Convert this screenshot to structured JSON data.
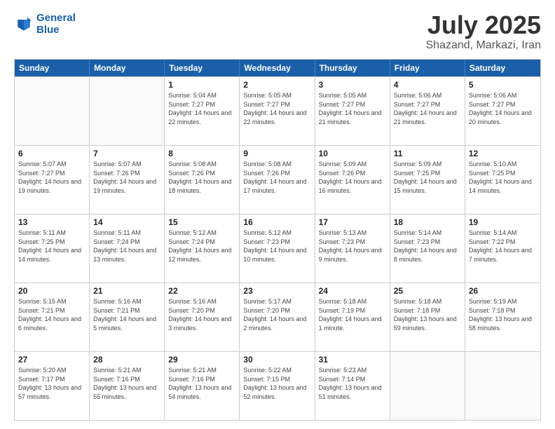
{
  "header": {
    "logo_line1": "General",
    "logo_line2": "Blue",
    "month": "July 2025",
    "location": "Shazand, Markazi, Iran"
  },
  "weekdays": [
    "Sunday",
    "Monday",
    "Tuesday",
    "Wednesday",
    "Thursday",
    "Friday",
    "Saturday"
  ],
  "rows": [
    [
      {
        "day": "",
        "sunrise": "",
        "sunset": "",
        "daylight": ""
      },
      {
        "day": "",
        "sunrise": "",
        "sunset": "",
        "daylight": ""
      },
      {
        "day": "1",
        "sunrise": "Sunrise: 5:04 AM",
        "sunset": "Sunset: 7:27 PM",
        "daylight": "Daylight: 14 hours and 22 minutes."
      },
      {
        "day": "2",
        "sunrise": "Sunrise: 5:05 AM",
        "sunset": "Sunset: 7:27 PM",
        "daylight": "Daylight: 14 hours and 22 minutes."
      },
      {
        "day": "3",
        "sunrise": "Sunrise: 5:05 AM",
        "sunset": "Sunset: 7:27 PM",
        "daylight": "Daylight: 14 hours and 21 minutes."
      },
      {
        "day": "4",
        "sunrise": "Sunrise: 5:06 AM",
        "sunset": "Sunset: 7:27 PM",
        "daylight": "Daylight: 14 hours and 21 minutes."
      },
      {
        "day": "5",
        "sunrise": "Sunrise: 5:06 AM",
        "sunset": "Sunset: 7:27 PM",
        "daylight": "Daylight: 14 hours and 20 minutes."
      }
    ],
    [
      {
        "day": "6",
        "sunrise": "Sunrise: 5:07 AM",
        "sunset": "Sunset: 7:27 PM",
        "daylight": "Daylight: 14 hours and 19 minutes."
      },
      {
        "day": "7",
        "sunrise": "Sunrise: 5:07 AM",
        "sunset": "Sunset: 7:26 PM",
        "daylight": "Daylight: 14 hours and 19 minutes."
      },
      {
        "day": "8",
        "sunrise": "Sunrise: 5:08 AM",
        "sunset": "Sunset: 7:26 PM",
        "daylight": "Daylight: 14 hours and 18 minutes."
      },
      {
        "day": "9",
        "sunrise": "Sunrise: 5:08 AM",
        "sunset": "Sunset: 7:26 PM",
        "daylight": "Daylight: 14 hours and 17 minutes."
      },
      {
        "day": "10",
        "sunrise": "Sunrise: 5:09 AM",
        "sunset": "Sunset: 7:26 PM",
        "daylight": "Daylight: 14 hours and 16 minutes."
      },
      {
        "day": "11",
        "sunrise": "Sunrise: 5:09 AM",
        "sunset": "Sunset: 7:25 PM",
        "daylight": "Daylight: 14 hours and 15 minutes."
      },
      {
        "day": "12",
        "sunrise": "Sunrise: 5:10 AM",
        "sunset": "Sunset: 7:25 PM",
        "daylight": "Daylight: 14 hours and 14 minutes."
      }
    ],
    [
      {
        "day": "13",
        "sunrise": "Sunrise: 5:11 AM",
        "sunset": "Sunset: 7:25 PM",
        "daylight": "Daylight: 14 hours and 14 minutes."
      },
      {
        "day": "14",
        "sunrise": "Sunrise: 5:11 AM",
        "sunset": "Sunset: 7:24 PM",
        "daylight": "Daylight: 14 hours and 13 minutes."
      },
      {
        "day": "15",
        "sunrise": "Sunrise: 5:12 AM",
        "sunset": "Sunset: 7:24 PM",
        "daylight": "Daylight: 14 hours and 12 minutes."
      },
      {
        "day": "16",
        "sunrise": "Sunrise: 5:12 AM",
        "sunset": "Sunset: 7:23 PM",
        "daylight": "Daylight: 14 hours and 10 minutes."
      },
      {
        "day": "17",
        "sunrise": "Sunrise: 5:13 AM",
        "sunset": "Sunset: 7:23 PM",
        "daylight": "Daylight: 14 hours and 9 minutes."
      },
      {
        "day": "18",
        "sunrise": "Sunrise: 5:14 AM",
        "sunset": "Sunset: 7:23 PM",
        "daylight": "Daylight: 14 hours and 8 minutes."
      },
      {
        "day": "19",
        "sunrise": "Sunrise: 5:14 AM",
        "sunset": "Sunset: 7:22 PM",
        "daylight": "Daylight: 14 hours and 7 minutes."
      }
    ],
    [
      {
        "day": "20",
        "sunrise": "Sunrise: 5:15 AM",
        "sunset": "Sunset: 7:21 PM",
        "daylight": "Daylight: 14 hours and 6 minutes."
      },
      {
        "day": "21",
        "sunrise": "Sunrise: 5:16 AM",
        "sunset": "Sunset: 7:21 PM",
        "daylight": "Daylight: 14 hours and 5 minutes."
      },
      {
        "day": "22",
        "sunrise": "Sunrise: 5:16 AM",
        "sunset": "Sunset: 7:20 PM",
        "daylight": "Daylight: 14 hours and 3 minutes."
      },
      {
        "day": "23",
        "sunrise": "Sunrise: 5:17 AM",
        "sunset": "Sunset: 7:20 PM",
        "daylight": "Daylight: 14 hours and 2 minutes."
      },
      {
        "day": "24",
        "sunrise": "Sunrise: 5:18 AM",
        "sunset": "Sunset: 7:19 PM",
        "daylight": "Daylight: 14 hours and 1 minute."
      },
      {
        "day": "25",
        "sunrise": "Sunrise: 5:18 AM",
        "sunset": "Sunset: 7:18 PM",
        "daylight": "Daylight: 13 hours and 59 minutes."
      },
      {
        "day": "26",
        "sunrise": "Sunrise: 5:19 AM",
        "sunset": "Sunset: 7:18 PM",
        "daylight": "Daylight: 13 hours and 58 minutes."
      }
    ],
    [
      {
        "day": "27",
        "sunrise": "Sunrise: 5:20 AM",
        "sunset": "Sunset: 7:17 PM",
        "daylight": "Daylight: 13 hours and 57 minutes."
      },
      {
        "day": "28",
        "sunrise": "Sunrise: 5:21 AM",
        "sunset": "Sunset: 7:16 PM",
        "daylight": "Daylight: 13 hours and 55 minutes."
      },
      {
        "day": "29",
        "sunrise": "Sunrise: 5:21 AM",
        "sunset": "Sunset: 7:16 PM",
        "daylight": "Daylight: 13 hours and 54 minutes."
      },
      {
        "day": "30",
        "sunrise": "Sunrise: 5:22 AM",
        "sunset": "Sunset: 7:15 PM",
        "daylight": "Daylight: 13 hours and 52 minutes."
      },
      {
        "day": "31",
        "sunrise": "Sunrise: 5:23 AM",
        "sunset": "Sunset: 7:14 PM",
        "daylight": "Daylight: 13 hours and 51 minutes."
      },
      {
        "day": "",
        "sunrise": "",
        "sunset": "",
        "daylight": ""
      },
      {
        "day": "",
        "sunrise": "",
        "sunset": "",
        "daylight": ""
      }
    ]
  ]
}
